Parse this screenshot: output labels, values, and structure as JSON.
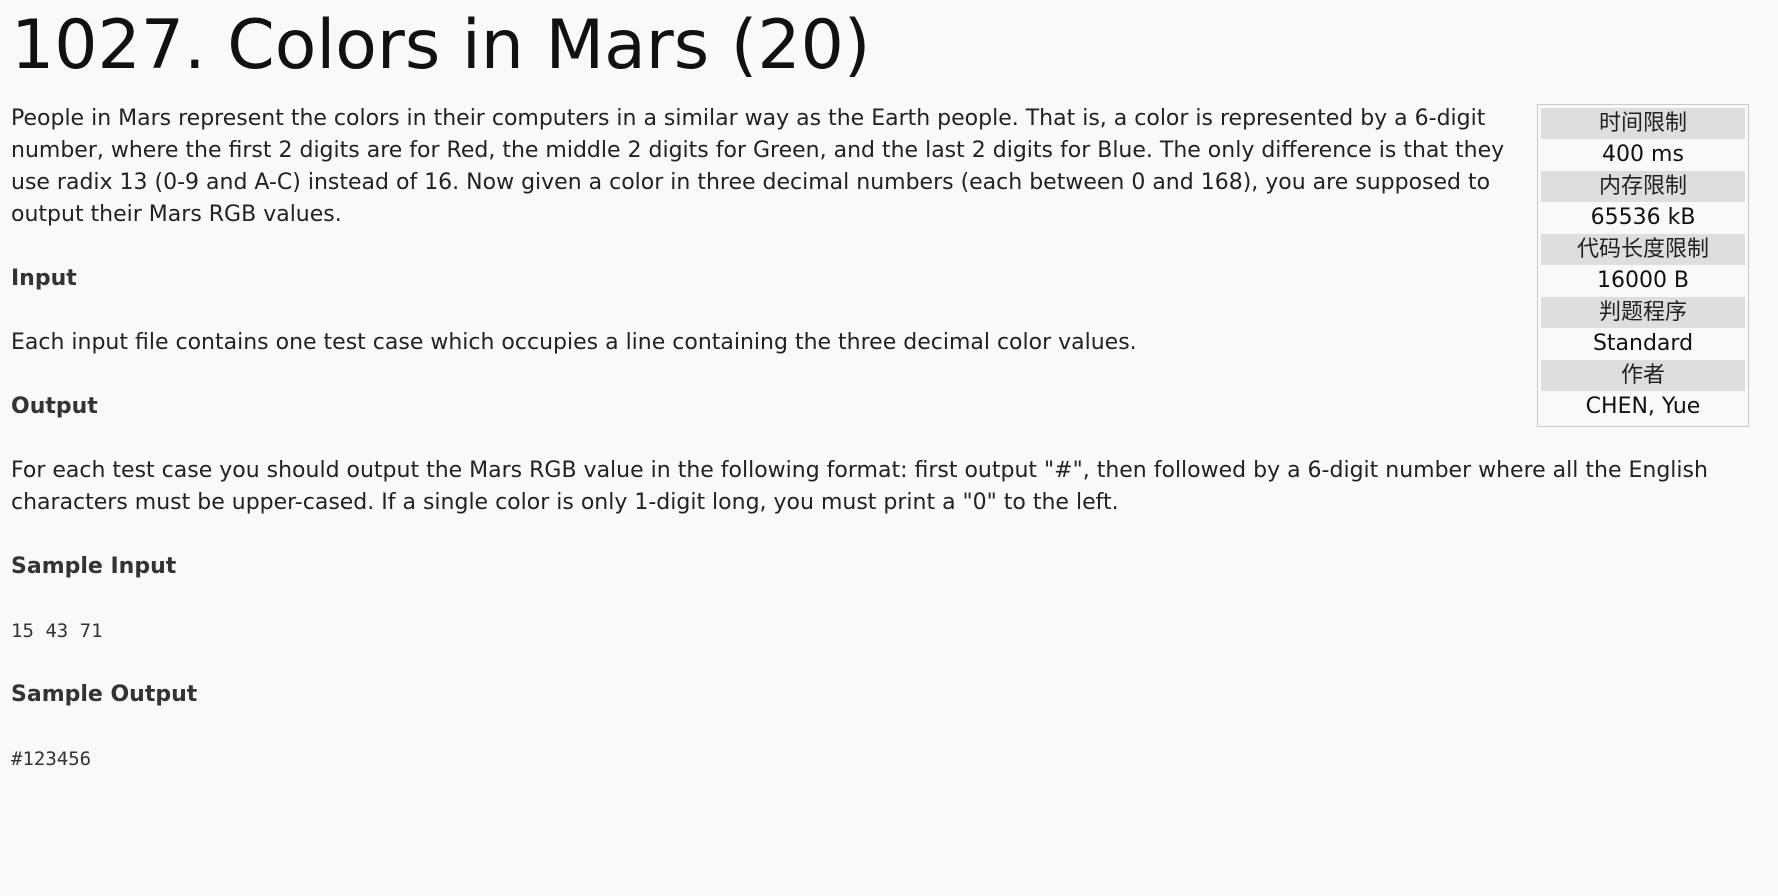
{
  "problem": {
    "title": "1027. Colors in Mars (20)"
  },
  "limits": [
    {
      "label": "时间限制",
      "value": "400 ms"
    },
    {
      "label": "内存限制",
      "value": "65536 kB"
    },
    {
      "label": "代码长度限制",
      "value": "16000 B"
    },
    {
      "label": "判题程序",
      "value": "Standard"
    },
    {
      "label": "作者",
      "value": "CHEN, Yue"
    }
  ],
  "body": {
    "description": "People in Mars represent the colors in their computers in a similar way as the Earth people. That is, a color is represented by a 6-digit number, where the first 2 digits are for Red, the middle 2 digits for Green, and the last 2 digits for Blue. The only difference is that they use radix 13 (0-9 and A-C) instead of 16. Now given a color in three decimal numbers (each between 0 and 168), you are supposed to output their Mars RGB values.",
    "input_heading": "Input",
    "input_text": "Each input file contains one test case which occupies a line containing the three decimal color values.",
    "output_heading": "Output",
    "output_text": "For each test case you should output the Mars RGB value in the following format: first output \"#\", then followed by a 6-digit number where all the English characters must be upper-cased. If a single color is only 1-digit long, you must print a \"0\" to the left.",
    "sample_input_heading": "Sample Input",
    "sample_input": "15 43 71",
    "sample_output_heading": "Sample Output",
    "sample_output": "#123456"
  }
}
